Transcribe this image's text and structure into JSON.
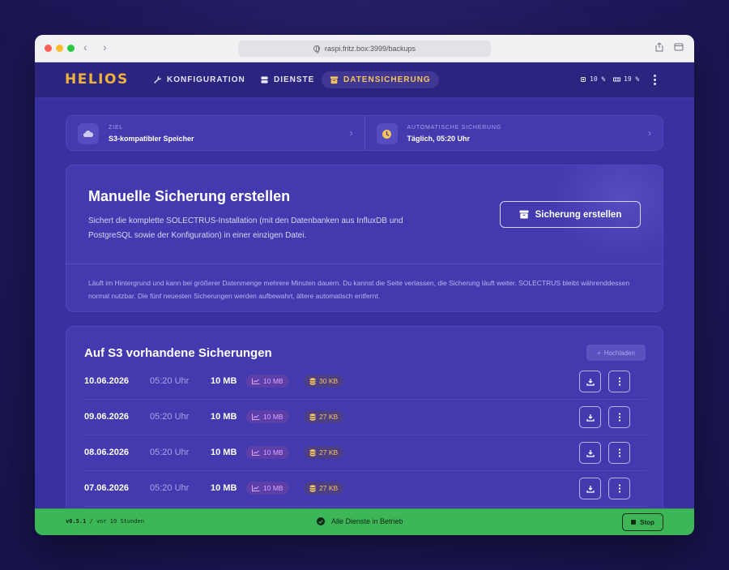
{
  "browser": {
    "url": "raspi.fritz.box:3999/backups",
    "back_glyph": "‹",
    "forward_glyph": "›"
  },
  "header": {
    "logo": "HELIOS",
    "nav": [
      {
        "label": "KONFIGURATION",
        "icon": "wrench-icon"
      },
      {
        "label": "DIENSTE",
        "icon": "server-icon"
      },
      {
        "label": "DATENSICHERUNG",
        "icon": "archive-icon",
        "active": true
      }
    ],
    "cpu": "10 %",
    "memory": "19 %"
  },
  "targets": {
    "ziel": {
      "label": "ZIEL",
      "value": "S3-kompatibler Speicher",
      "icon": "cloud-icon"
    },
    "auto": {
      "label": "AUTOMATISCHE SICHERUNG",
      "value": "Täglich, 05:20 Uhr",
      "icon": "clock-icon"
    },
    "chevron": "›"
  },
  "manual": {
    "title": "Manuelle Sicherung erstellen",
    "description": "Sichert die komplette SOLECTRUS-Installation (mit den Datenbanken aus InfluxDB und PostgreSQL sowie der Konfiguration) in einer einzigen Datei.",
    "button_label": "Sicherung erstellen",
    "note": "Läuft im Hintergrund und kann bei größerer Datenmenge mehrere Minuten dauern. Du kannst die Seite verlassen, die Sicherung läuft weiter. SOLECTRUS bleibt währenddessen normal nutzbar. Die fünf neuesten Sicherungen werden aufbewahrt, ältere automatisch entfernt."
  },
  "backups": {
    "title": "Auf S3 vorhandene Sicherungen",
    "upload_label": "Hochladen",
    "upload_glyph": "+",
    "rows": [
      {
        "date": "10.06.2026",
        "time": "05:20 Uhr",
        "size": "10 MB",
        "influx": "10 MB",
        "postgres": "30 KB"
      },
      {
        "date": "09.06.2026",
        "time": "05:20 Uhr",
        "size": "10 MB",
        "influx": "10 MB",
        "postgres": "27 KB"
      },
      {
        "date": "08.06.2026",
        "time": "05:20 Uhr",
        "size": "10 MB",
        "influx": "10 MB",
        "postgres": "27 KB"
      },
      {
        "date": "07.06.2026",
        "time": "05:20 Uhr",
        "size": "10 MB",
        "influx": "10 MB",
        "postgres": "27 KB"
      }
    ]
  },
  "footer": {
    "version": "v0.5.1",
    "uptime": "/ vor 19 Stunden",
    "status": "Alle Dienste in Betrieb",
    "stop_label": "Stop"
  },
  "colors": {
    "accent": "#f2b13b",
    "background": "#3a31a0",
    "footer_green": "#3cb657"
  }
}
